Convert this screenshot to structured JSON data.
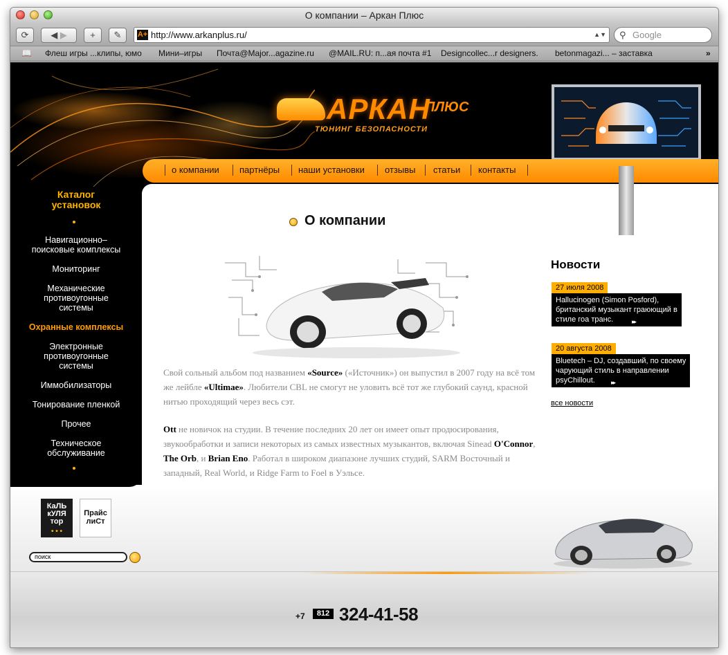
{
  "browser": {
    "window_title": "О компании – Аркан Плюс",
    "url": "http://www.arkanplus.ru/",
    "search_placeholder": "Google",
    "bookmarks": [
      "Флеш игры ...клипы, юмо",
      "Мини–игры",
      "Почта@Major...agazine.ru",
      "@MAIL.RU: п...ая почта #1",
      "Designcollec...r designers.",
      "betonmagazi... – заставка"
    ]
  },
  "site": {
    "logo_word": "АРКАН",
    "logo_plus": "ПЛЮС",
    "logo_tagline": "ТЮНИНГ БЕЗОПАСНОСТИ",
    "nav": [
      "о компании",
      "партнёры",
      "наши установки",
      "отзывы",
      "статьи",
      "контакты"
    ],
    "catalog_title_1": "Каталог",
    "catalog_title_2": "установок",
    "catalog": [
      [
        "Навигационно–",
        "поисковые комплексы"
      ],
      [
        "Мониторинг"
      ],
      [
        "Механические",
        "противоугонные",
        "системы"
      ],
      [
        "Охранные комплексы"
      ],
      [
        "Электронные",
        "противоугонные",
        "системы"
      ],
      [
        "Иммобилизаторы"
      ],
      [
        "Тонирование пленкой"
      ],
      [
        "Прочее"
      ],
      [
        "Техническое",
        "обслуживание"
      ]
    ],
    "page_title": "О компании",
    "para1": {
      "t1": "Свой сольный альбом под названием ",
      "b1": "«Source»",
      "t2": " («Источник») он выпустил  в 2007 году на всё том же лейбле ",
      "b2": "«Ultimae»",
      "t3": ". Любители CBL не смогут не уловить всё тот же глубокий саунд, красной нитью проходящий через весь сэт."
    },
    "para2": {
      "b1": "Ott",
      "t1": " не новичок на студии. В течение последних 20 лет он имеет опыт продюсирования, звукообработки и записи некоторых из самых известных музыкантов, включая Sinead ",
      "b2": "O'Connor",
      "t2": ", ",
      "b3": "The Orb",
      "t3": ", и ",
      "b4": "Brian Eno",
      "t4": ". Работал в широком диапазоне лучших студий, SARM Восточный и западный, Real World, и Ridge Farm to Foel в Уэльсе."
    },
    "news_title": "Новости",
    "news": [
      {
        "date": "27 июля 2008",
        "lines": [
          "Hallucinogen (Simon Posford),",
          "британский музыкант  граюющий в",
          "стиле гоа транс."
        ]
      },
      {
        "date": "20 августа 2008",
        "lines": [
          "Bluetech – DJ, создавший, по своему",
          "чарующий стиль в направлении",
          "psyChillout."
        ]
      }
    ],
    "news_more": "▸▸",
    "all_news": "все новости",
    "calc_label": [
      "КаЛЬ",
      "кУЛЯ",
      "тор"
    ],
    "price_label": [
      "Прайс",
      "лиСт"
    ],
    "search_value": "поиск",
    "phone_prefix": "+7",
    "phone_code": "812",
    "phone_number": "324-41-58"
  },
  "colors": {
    "accent": "#ff8a00",
    "accent_light": "#ffb400",
    "background": "#000000"
  }
}
